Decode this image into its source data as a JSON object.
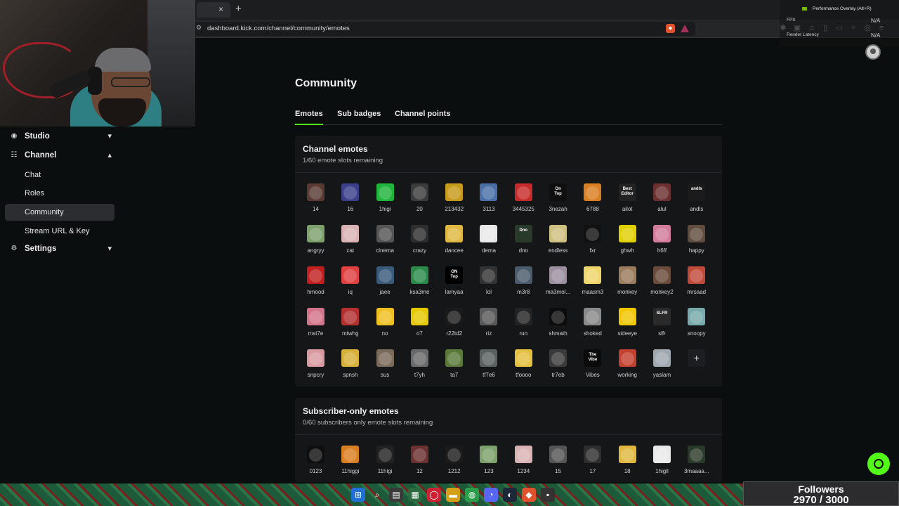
{
  "browser": {
    "url": "dashboard.kick.com/channel/community/emotes",
    "tab_close": "×",
    "new_tab": "+"
  },
  "overlay": {
    "title": "Performance Overlay (Alt+R)",
    "fps_label": "FPS",
    "fps_value": "N/A",
    "latency_label": "Render Latency",
    "latency_value": "N/A"
  },
  "sidebar": {
    "items": [
      {
        "label": "Studio",
        "icon": "studio-icon",
        "chevron": "▾"
      },
      {
        "label": "Channel",
        "icon": "channel-icon",
        "chevron": "▴"
      },
      {
        "label": "Settings",
        "icon": "gear-icon",
        "chevron": "▾"
      }
    ],
    "channel_children": [
      "Chat",
      "Roles",
      "Community",
      "Stream URL & Key"
    ],
    "active": "Community"
  },
  "page": {
    "title": "Community",
    "tabs": [
      "Emotes",
      "Sub badges",
      "Channel points"
    ],
    "active_tab": "Emotes"
  },
  "channel_emotes": {
    "title": "Channel emotes",
    "subtitle": "1/60 emote slots remaining",
    "items": [
      "14",
      "16",
      "1higi",
      "20",
      "213432",
      "3113",
      "3445325",
      "3nezah",
      "6788",
      "ailot",
      "alul",
      "andls",
      "angryy",
      "cat",
      "cinema",
      "crazy",
      "dancee",
      "dema",
      "dno",
      "endless",
      "fxr",
      "ghwh",
      "h6ff",
      "happy",
      "hmood",
      "iq",
      "jaee",
      "ksa3me",
      "lamyaa",
      "lol",
      "m3r8",
      "ma3mol...",
      "maasm3",
      "monkey",
      "monkey2",
      "mrsaad",
      "mst7e",
      "mtwhg",
      "no",
      "o7",
      "r22td2",
      "riz",
      "run",
      "shmath",
      "shoked",
      "sideeye",
      "slfr",
      "snoopy",
      "snpcry",
      "spnsh",
      "sus",
      "t7yh",
      "ta7",
      "tf7e6",
      "tfoooo",
      "tr7eb",
      "Vibes",
      "working",
      "yaslam"
    ],
    "add_label": "+"
  },
  "subscriber_emotes": {
    "title": "Subscriber-only emotes",
    "subtitle": "0/60 subscribers only emote slots remaining",
    "items": [
      "0123",
      "11higgi",
      "11higi",
      "12",
      "1212",
      "123",
      "1234",
      "15",
      "17",
      "18",
      "1higll",
      "3maaaa..."
    ]
  },
  "emote_text": {
    "3nezah": "On\nTop",
    "ailot": "Best\nEditor",
    "lamyaa": "ON\nTop",
    "Vibes": "The\nVibe",
    "dno": "Dno",
    "slfr": "SLFR",
    "andls": "andls"
  },
  "followers": {
    "label": "Followers",
    "value": "2970 / 3000"
  }
}
